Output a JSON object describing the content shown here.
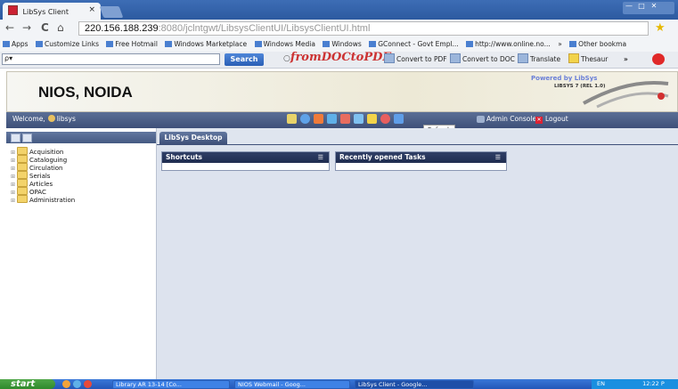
{
  "browser": {
    "tab_title": "LibSys Client",
    "tab_close": "×",
    "url_host": "220.156.188.239",
    "url_rest": ":8080/jclntgwt/LibsysClientUI/LibsysClientUI.html",
    "nav": {
      "back": "←",
      "forward": "→",
      "reload": "C",
      "home": "⌂"
    },
    "bookmarks": [
      "Apps",
      "Customize Links",
      "Free Hotmail",
      "Windows Marketplace",
      "Windows Media",
      "Windows",
      "GConnect - Govt Empl...",
      "http://www.online.no...",
      "»",
      "Other bookma"
    ],
    "toolbar": {
      "search_placeholder": "ρ▾",
      "search_button": "Search",
      "logo_main": "fromDOCtoPDF",
      "convert_pdf": "Convert to PDF",
      "convert_doc": "Convert to DOC",
      "translate": "Translate",
      "thesaurus": "Thesaur",
      "more": "»"
    }
  },
  "app": {
    "org_name": "NIOS, NOIDA",
    "powered_by": "Powered by LibSys",
    "version": "LIBSYS 7 (REL 1.0)",
    "welcome": "Welcome,",
    "user": "libsys",
    "admin_console": "Admin Console",
    "logout": "Logout",
    "tooltip": "Refresh",
    "toolbar_icon_colors": [
      "#e8d36a",
      "#5fa2e8",
      "#f07b3a",
      "#5fb0e8",
      "#e86d5f",
      "#7fc1f0",
      "#f2d34a",
      "#e85f5f",
      "#5f9ee8",
      "#6fa8e0"
    ]
  },
  "nav_tree": {
    "items": [
      "Acquisition",
      "Cataloguing",
      "Circulation",
      "Serials",
      "Articles",
      "OPAC",
      "Administration"
    ]
  },
  "desktop": {
    "tab": "LibSys Desktop",
    "portlets": [
      {
        "title": "Shortcuts"
      },
      {
        "title": "Recently opened Tasks"
      }
    ]
  },
  "taskbar": {
    "start": "start",
    "tasks": [
      "Library AR 13-14 [Co...",
      "NIOS Webmail - Goog...",
      "LibSys Client - Google..."
    ],
    "tray": "EN",
    "clock": "12:22 P"
  }
}
